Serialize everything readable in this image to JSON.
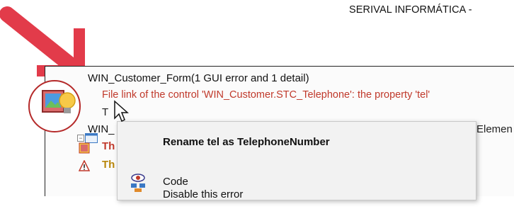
{
  "header": {
    "company": "SERIVAL INFORMÁTICA -"
  },
  "tree": {
    "form_node": "WIN_Customer_Form(1 GUI error and 1 detail)",
    "error_line": "File link of the control 'WIN_Customer.STC_Telephone': the property 'tel'",
    "truncated_t": "T",
    "win_node": "WIN_",
    "th_error": "Th",
    "th_warning": "Th",
    "right_column": "Elemen"
  },
  "context_menu": {
    "rename_label": "Rename tel as TelephoneNumber",
    "code_label": "Code",
    "disable_label": "Disable this error"
  },
  "colors": {
    "error_text": "#c0392b",
    "warning_text": "#b8860b",
    "arrow_red": "#e23b4a",
    "circle_red": "#b52a2a"
  },
  "icons": [
    "pointer-arrow-icon",
    "gui-error-icon",
    "window-icon",
    "error-image-icon",
    "warning-triangle-icon",
    "code-eye-icon",
    "mouse-cursor-icon"
  ]
}
